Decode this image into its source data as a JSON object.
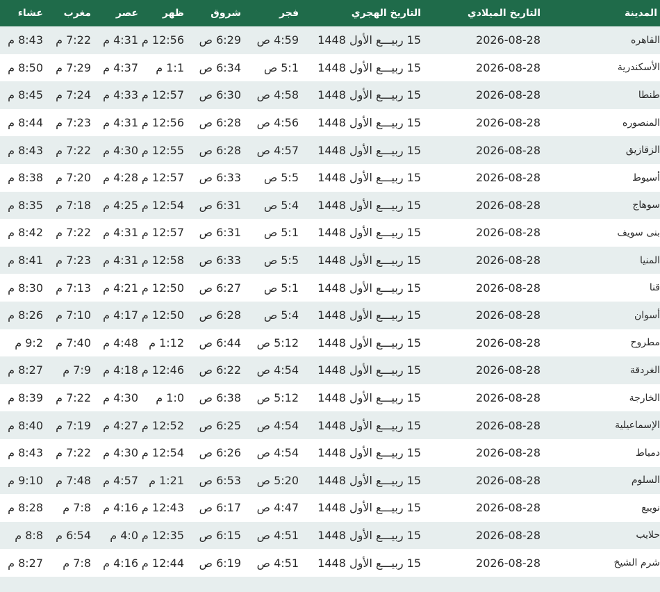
{
  "header": {
    "city": "المدينة",
    "gregorian": "التاريخ الميلادي",
    "hijri": "التاريخ الهجري",
    "fajr": "فجر",
    "shuruq": "شروق",
    "dhuhr": "ظهر",
    "asr": "عصر",
    "maghrib": "مغرب",
    "isha": "عشاء"
  },
  "rows": [
    {
      "city": "القاهره",
      "gregorian": "2026-08-28",
      "hijri": "15 ربيـــع الأول 1448",
      "fajr": "4:59 ص",
      "shuruq": "6:29 ص",
      "dhuhr": "12:56 م",
      "asr": "4:31 م",
      "maghrib": "7:22 م",
      "isha": "8:43 م"
    },
    {
      "city": "الأسكندرية",
      "gregorian": "2026-08-28",
      "hijri": "15 ربيـــع الأول 1448",
      "fajr": "5:1 ص",
      "shuruq": "6:34 ص",
      "dhuhr": "1:1 م",
      "asr": "4:37 م",
      "maghrib": "7:29 م",
      "isha": "8:50 م"
    },
    {
      "city": "طنطا",
      "gregorian": "2026-08-28",
      "hijri": "15 ربيـــع الأول 1448",
      "fajr": "4:58 ص",
      "shuruq": "6:30 ص",
      "dhuhr": "12:57 م",
      "asr": "4:33 م",
      "maghrib": "7:24 م",
      "isha": "8:45 م"
    },
    {
      "city": "المنصوره",
      "gregorian": "2026-08-28",
      "hijri": "15 ربيـــع الأول 1448",
      "fajr": "4:56 ص",
      "shuruq": "6:28 ص",
      "dhuhr": "12:56 م",
      "asr": "4:31 م",
      "maghrib": "7:23 م",
      "isha": "8:44 م"
    },
    {
      "city": "الزقازيق",
      "gregorian": "2026-08-28",
      "hijri": "15 ربيـــع الأول 1448",
      "fajr": "4:57 ص",
      "shuruq": "6:28 ص",
      "dhuhr": "12:55 م",
      "asr": "4:30 م",
      "maghrib": "7:22 م",
      "isha": "8:43 م"
    },
    {
      "city": "أسيوط",
      "gregorian": "2026-08-28",
      "hijri": "15 ربيـــع الأول 1448",
      "fajr": "5:5 ص",
      "shuruq": "6:33 ص",
      "dhuhr": "12:57 م",
      "asr": "4:28 م",
      "maghrib": "7:20 م",
      "isha": "8:38 م"
    },
    {
      "city": "سوهاج",
      "gregorian": "2026-08-28",
      "hijri": "15 ربيـــع الأول 1448",
      "fajr": "5:4 ص",
      "shuruq": "6:31 ص",
      "dhuhr": "12:54 م",
      "asr": "4:25 م",
      "maghrib": "7:18 م",
      "isha": "8:35 م"
    },
    {
      "city": "بنى سويف",
      "gregorian": "2026-08-28",
      "hijri": "15 ربيـــع الأول 1448",
      "fajr": "5:1 ص",
      "shuruq": "6:31 ص",
      "dhuhr": "12:57 م",
      "asr": "4:31 م",
      "maghrib": "7:22 م",
      "isha": "8:42 م"
    },
    {
      "city": "المنيا",
      "gregorian": "2026-08-28",
      "hijri": "15 ربيـــع الأول 1448",
      "fajr": "5:5 ص",
      "shuruq": "6:33 ص",
      "dhuhr": "12:58 م",
      "asr": "4:31 م",
      "maghrib": "7:23 م",
      "isha": "8:41 م"
    },
    {
      "city": "قنا",
      "gregorian": "2026-08-28",
      "hijri": "15 ربيـــع الأول 1448",
      "fajr": "5:1 ص",
      "shuruq": "6:27 ص",
      "dhuhr": "12:50 م",
      "asr": "4:21 م",
      "maghrib": "7:13 م",
      "isha": "8:30 م"
    },
    {
      "city": "أسوان",
      "gregorian": "2026-08-28",
      "hijri": "15 ربيـــع الأول 1448",
      "fajr": "5:4 ص",
      "shuruq": "6:28 ص",
      "dhuhr": "12:50 م",
      "asr": "4:17 م",
      "maghrib": "7:10 م",
      "isha": "8:26 م"
    },
    {
      "city": "مطروح",
      "gregorian": "2026-08-28",
      "hijri": "15 ربيـــع الأول 1448",
      "fajr": "5:12 ص",
      "shuruq": "6:44 ص",
      "dhuhr": "1:12 م",
      "asr": "4:48 م",
      "maghrib": "7:40 م",
      "isha": "9:2 م"
    },
    {
      "city": "الغردقة",
      "gregorian": "2026-08-28",
      "hijri": "15 ربيـــع الأول 1448",
      "fajr": "4:54 ص",
      "shuruq": "6:22 ص",
      "dhuhr": "12:46 م",
      "asr": "4:18 م",
      "maghrib": "7:9 م",
      "isha": "8:27 م"
    },
    {
      "city": "الخارجة",
      "gregorian": "2026-08-28",
      "hijri": "15 ربيـــع الأول 1448",
      "fajr": "5:12 ص",
      "shuruq": "6:38 ص",
      "dhuhr": "1:0 م",
      "asr": "4:30 م",
      "maghrib": "7:22 م",
      "isha": "8:39 م"
    },
    {
      "city": "الإسماعيلية",
      "gregorian": "2026-08-28",
      "hijri": "15 ربيـــع الأول 1448",
      "fajr": "4:54 ص",
      "shuruq": "6:25 ص",
      "dhuhr": "12:52 م",
      "asr": "4:27 م",
      "maghrib": "7:19 م",
      "isha": "8:40 م"
    },
    {
      "city": "دمياط",
      "gregorian": "2026-08-28",
      "hijri": "15 ربيـــع الأول 1448",
      "fajr": "4:54 ص",
      "shuruq": "6:26 ص",
      "dhuhr": "12:54 م",
      "asr": "4:30 م",
      "maghrib": "7:22 م",
      "isha": "8:43 م"
    },
    {
      "city": "السلوم",
      "gregorian": "2026-08-28",
      "hijri": "15 ربيـــع الأول 1448",
      "fajr": "5:20 ص",
      "shuruq": "6:53 ص",
      "dhuhr": "1:21 م",
      "asr": "4:57 م",
      "maghrib": "7:48 م",
      "isha": "9:10 م"
    },
    {
      "city": "نويبع",
      "gregorian": "2026-08-28",
      "hijri": "15 ربيـــع الأول 1448",
      "fajr": "4:47 ص",
      "shuruq": "6:17 ص",
      "dhuhr": "12:43 م",
      "asr": "4:16 م",
      "maghrib": "7:8 م",
      "isha": "8:28 م"
    },
    {
      "city": "حلايب",
      "gregorian": "2026-08-28",
      "hijri": "15 ربيـــع الأول 1448",
      "fajr": "4:51 ص",
      "shuruq": "6:15 ص",
      "dhuhr": "12:35 م",
      "asr": "4:0 م",
      "maghrib": "6:54 م",
      "isha": "8:8 م"
    },
    {
      "city": "شرم الشيخ",
      "gregorian": "2026-08-28",
      "hijri": "15 ربيـــع الأول 1448",
      "fajr": "4:51 ص",
      "shuruq": "6:19 ص",
      "dhuhr": "12:44 م",
      "asr": "4:16 م",
      "maghrib": "7:8 م",
      "isha": "8:27 م"
    },
    {
      "city": "",
      "gregorian": "",
      "hijri": "",
      "fajr": "",
      "shuruq": "",
      "dhuhr": "",
      "asr": "",
      "maghrib": "",
      "isha": ""
    }
  ]
}
